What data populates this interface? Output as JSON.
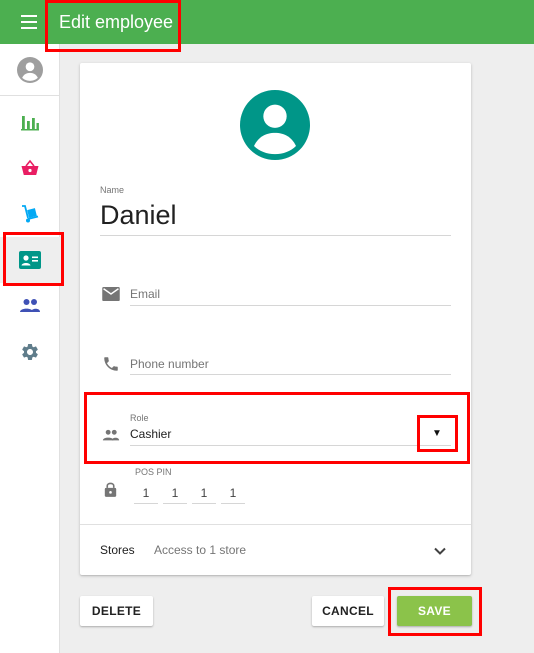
{
  "header": {
    "title": "Edit employee",
    "menu_icon": "menu-icon"
  },
  "sidebar": {
    "account_icon": "account-circle-icon",
    "items": [
      {
        "icon": "bar-chart-icon",
        "active": false,
        "color": "#4caf50"
      },
      {
        "icon": "basket-icon",
        "active": false,
        "color": "#e91e63"
      },
      {
        "icon": "hand-truck-icon",
        "active": false,
        "color": "#03a9f4"
      },
      {
        "icon": "badge-icon",
        "active": true,
        "color": "#009688"
      },
      {
        "icon": "people-icon",
        "active": false,
        "color": "#3f51b5"
      },
      {
        "icon": "settings-icon",
        "active": false,
        "color": "#607d8b"
      }
    ]
  },
  "form": {
    "name_label": "Name",
    "name_value": "Daniel",
    "email_placeholder": "Email",
    "phone_placeholder": "Phone number",
    "role_label": "Role",
    "role_value": "Cashier",
    "role_caret": "▼",
    "pos_pin_label": "POS PIN",
    "pos_pin_digits": [
      "1",
      "1",
      "1",
      "1"
    ],
    "stores_label": "Stores",
    "stores_value": "Access to 1 store"
  },
  "actions": {
    "delete_label": "DELETE",
    "cancel_label": "CANCEL",
    "save_label": "SAVE"
  },
  "colors": {
    "header_bg": "#4caf50",
    "avatar_bg": "#009688",
    "save_bg": "#8bc34a",
    "highlight": "#ff0000"
  }
}
